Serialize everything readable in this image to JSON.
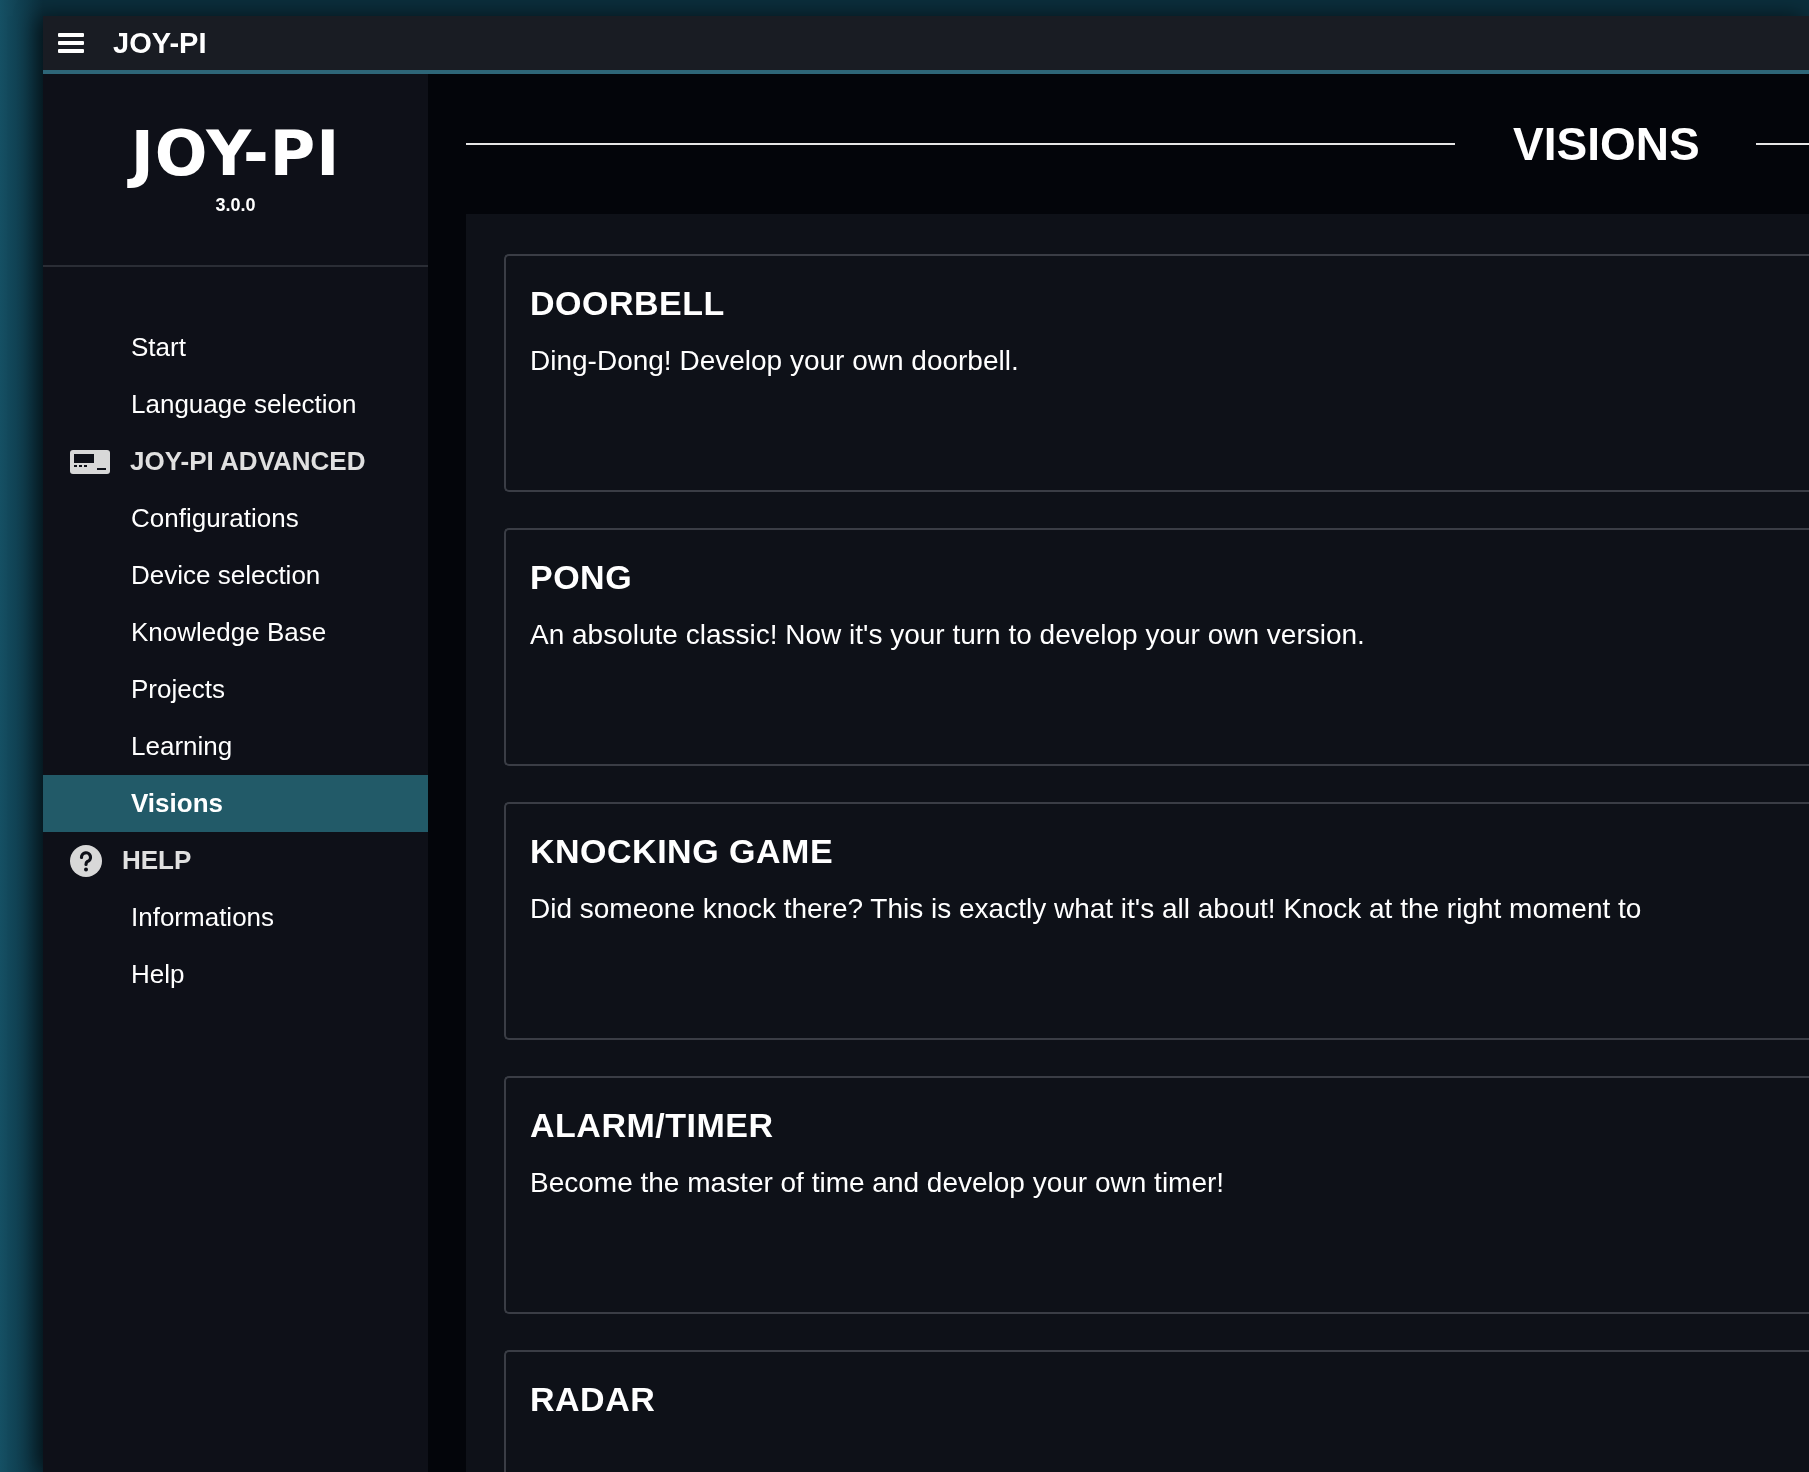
{
  "window": {
    "title": "JOY-PI"
  },
  "sidebar": {
    "logo": "JOY-PI",
    "version": "3.0.0",
    "items": [
      {
        "kind": "link",
        "label": "Start",
        "selected": false
      },
      {
        "kind": "link",
        "label": "Language selection",
        "selected": false
      },
      {
        "kind": "section",
        "label": "JOY-PI ADVANCED",
        "children": [
          {
            "kind": "link",
            "label": "Configurations",
            "selected": false
          },
          {
            "kind": "link",
            "label": "Device selection",
            "selected": false
          },
          {
            "kind": "link",
            "label": "Knowledge Base",
            "selected": false
          },
          {
            "kind": "link",
            "label": "Projects",
            "selected": false
          },
          {
            "kind": "link",
            "label": "Learning",
            "selected": false
          },
          {
            "kind": "link",
            "label": "Visions",
            "selected": true
          }
        ]
      },
      {
        "kind": "section",
        "label": "HELP",
        "children": [
          {
            "kind": "link",
            "label": "Informations",
            "selected": false
          },
          {
            "kind": "link",
            "label": "Help",
            "selected": false
          }
        ]
      }
    ]
  },
  "page": {
    "title": "VISIONS",
    "cards": [
      {
        "title": "DOORBELL",
        "description": "Ding-Dong! Develop your own doorbell."
      },
      {
        "title": "PONG",
        "description": "An absolute classic! Now it's your turn to develop your own version."
      },
      {
        "title": "KNOCKING GAME",
        "description": "Did someone knock there? This is exactly what it's all about! Knock at the right moment to"
      },
      {
        "title": "ALARM/TIMER",
        "description": "Become the master of time and develop your own timer!"
      },
      {
        "title": "RADAR"
      }
    ]
  }
}
